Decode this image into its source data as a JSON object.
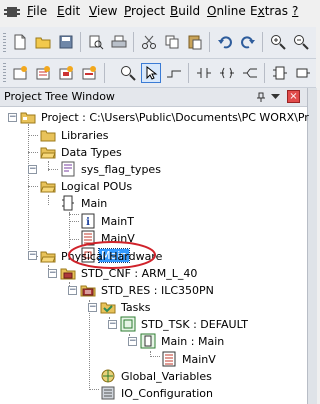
{
  "menubar": {
    "items": [
      "File",
      "Edit",
      "View",
      "Project",
      "Build",
      "Online",
      "Extras",
      "?"
    ],
    "mnemonics": [
      "F",
      "E",
      "V",
      "P",
      "B",
      "O",
      "x",
      "?"
    ]
  },
  "panel": {
    "title": "Project Tree Window",
    "buttons": [
      "pin-icon",
      "dropdown-icon",
      "close-icon"
    ]
  },
  "tree": {
    "nodes": [
      {
        "id": "project",
        "label": "Project : C:\\Users\\Public\\Documents\\PC WORX\\Pr",
        "icon": "project-icon",
        "expanded": true
      },
      {
        "id": "libraries",
        "label": "Libraries",
        "icon": "folder-icon"
      },
      {
        "id": "data-types",
        "label": "Data Types",
        "icon": "folder-open-icon",
        "expanded": true
      },
      {
        "id": "sys-flag-types",
        "label": "sys_flag_types",
        "icon": "datatype-file-icon"
      },
      {
        "id": "logical-pous",
        "label": "Logical POUs",
        "icon": "folder-open-icon",
        "expanded": true
      },
      {
        "id": "main-pou",
        "label": "Main",
        "icon": "program-icon",
        "expanded": true
      },
      {
        "id": "main-t",
        "label": "MainT",
        "icon": "info-icon"
      },
      {
        "id": "main-v",
        "label": "MainV",
        "icon": "variables-icon"
      },
      {
        "id": "main-code",
        "label": "Main",
        "icon": "code-sheet-icon",
        "selected": true
      },
      {
        "id": "physical-hardware",
        "label": "Physical Hardware",
        "icon": "hardware-folder-icon",
        "expanded": true
      },
      {
        "id": "std-cnf",
        "label": "STD_CNF : ARM_L_40",
        "icon": "configuration-icon",
        "expanded": true
      },
      {
        "id": "std-res",
        "label": "STD_RES : ILC350PN",
        "icon": "resource-icon",
        "expanded": true
      },
      {
        "id": "tasks",
        "label": "Tasks",
        "icon": "tasks-folder-icon",
        "expanded": true
      },
      {
        "id": "std-tsk",
        "label": "STD_TSK : DEFAULT",
        "icon": "task-icon",
        "expanded": true
      },
      {
        "id": "main-main",
        "label": "Main : Main",
        "icon": "program-instance-icon",
        "expanded": true
      },
      {
        "id": "main-v-inst",
        "label": "MainV",
        "icon": "variables-icon"
      },
      {
        "id": "global-variables",
        "label": "Global_Variables",
        "icon": "globals-icon"
      },
      {
        "id": "io-configuration",
        "label": "IO_Configuration",
        "icon": "io-config-icon"
      }
    ]
  },
  "colors": {
    "selection": "#3399ff",
    "annotation_circle": "#d0222a",
    "folder": "#e8c25a"
  }
}
